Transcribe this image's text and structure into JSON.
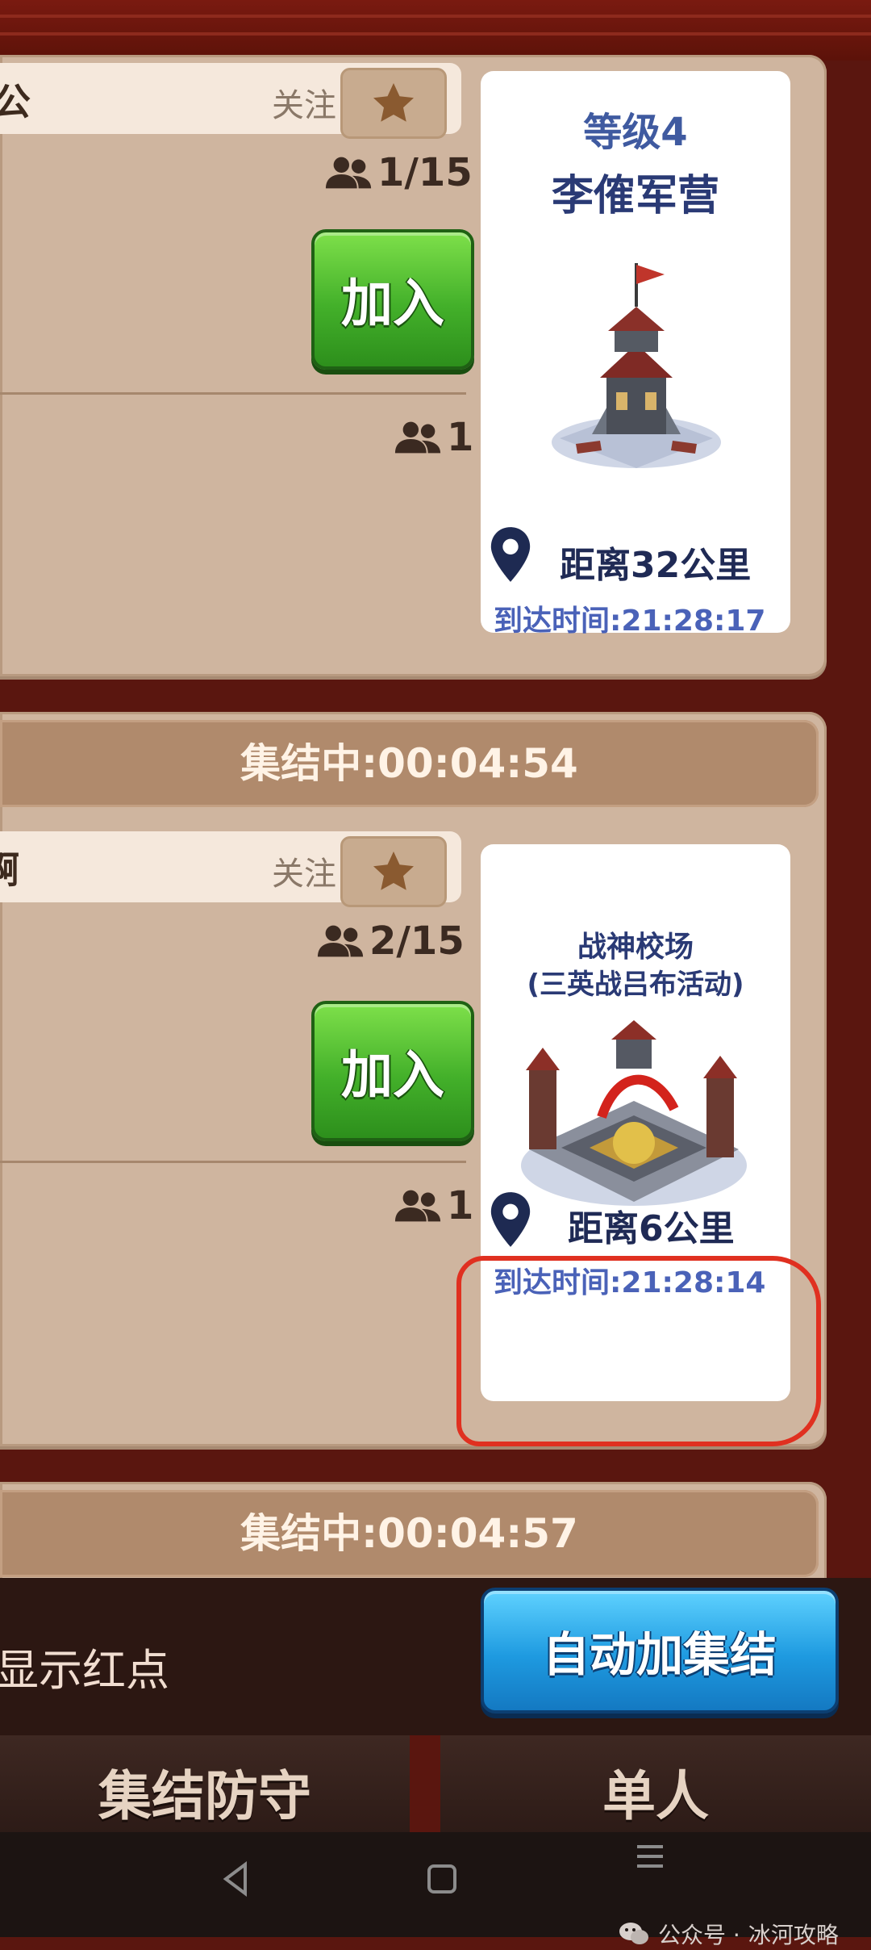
{
  "rallies": [
    {
      "name_partial": "公",
      "follow_label": "关注",
      "members_current": "1/15",
      "join_label": "加入",
      "second_member_count": "1",
      "target": {
        "level": "等级4",
        "name": "李傕军营",
        "distance": "距离32公里",
        "arrival": "到达时间:21:28:17"
      }
    },
    {
      "timer": "集结中:00:04:54",
      "name_partial": "啊",
      "follow_label": "关注",
      "members_current": "2/15",
      "join_label": "加入",
      "second_member_count": "1",
      "target": {
        "name_line1": "战神校场",
        "name_line2": "(三英战吕布活动)",
        "distance": "距离6公里",
        "arrival": "到达时间:21:28:14"
      }
    }
  ],
  "next_rally_timer": "集结中:00:04:57",
  "bottom": {
    "red_dot_label": "显示红点",
    "auto_rally_label": "自动加集结"
  },
  "tabs": [
    "集结防守",
    "单人"
  ],
  "watermark": {
    "prefix": "公众号 ·",
    "name": "冰河攻略"
  },
  "colors": {
    "join_green": "#43b02a",
    "auto_blue": "#1e9ae0",
    "annotation_red": "#e03020"
  }
}
